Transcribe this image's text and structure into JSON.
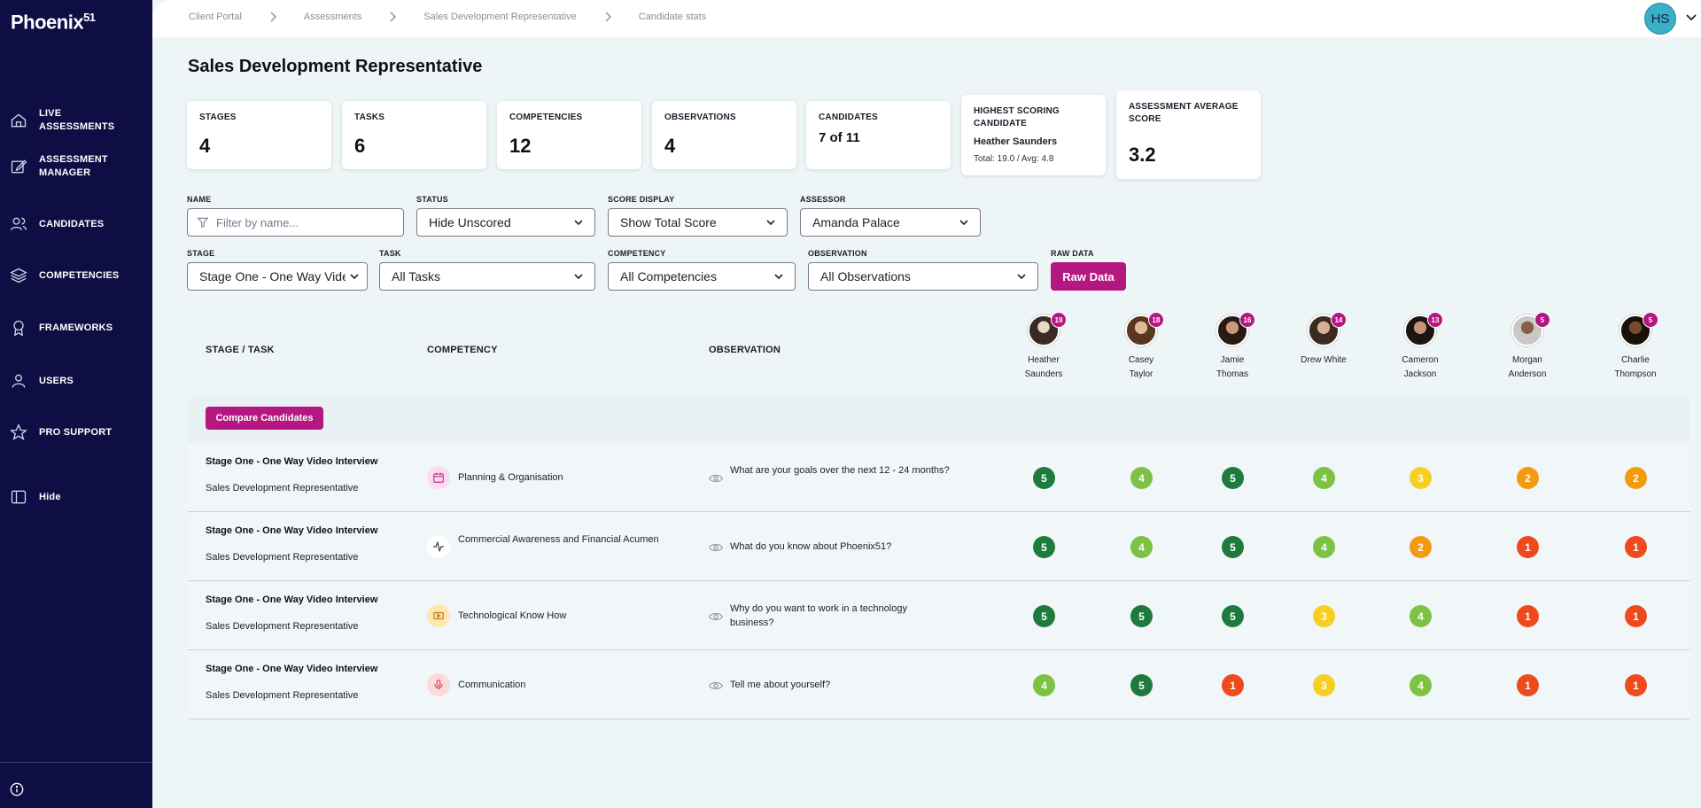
{
  "brand": {
    "name": "Phoenix",
    "suffix": "51"
  },
  "nav": [
    {
      "line1": "LIVE",
      "line2": "ASSESSMENTS",
      "icon": "home-icon"
    },
    {
      "line1": "ASSESSMENT",
      "line2": "MANAGER",
      "icon": "edit-icon"
    },
    {
      "line1": "CANDIDATES",
      "line2": "",
      "icon": "users-icon"
    },
    {
      "line1": "COMPETENCIES",
      "line2": "",
      "icon": "layers-icon"
    },
    {
      "line1": "FRAMEWORKS",
      "line2": "",
      "icon": "award-icon"
    },
    {
      "line1": "USERS",
      "line2": "",
      "icon": "user-icon"
    },
    {
      "line1": "PRO SUPPORT",
      "line2": "",
      "icon": "star-icon"
    },
    {
      "line1": "Hide",
      "line2": "",
      "icon": "sidebar-toggle-icon"
    }
  ],
  "breadcrumb": [
    "Client Portal",
    "Assessments",
    "Sales Development Representative",
    "Candidate stats"
  ],
  "user": {
    "initials": "HS"
  },
  "page": {
    "title": "Sales Development Representative"
  },
  "stats": {
    "stages": {
      "label": "STAGES",
      "value": "4"
    },
    "tasks": {
      "label": "TASKS",
      "value": "6"
    },
    "competencies": {
      "label": "COMPETENCIES",
      "value": "12"
    },
    "observations": {
      "label": "OBSERVATIONS",
      "value": "4"
    },
    "candidates": {
      "label": "CANDIDATES",
      "value": "7 of 11"
    },
    "highest": {
      "label": "HIGHEST SCORING CANDIDATE",
      "name": "Heather Saunders",
      "detail": "Total: 19.0 / Avg: 4.8"
    },
    "average": {
      "label": "ASSESSMENT AVERAGE SCORE",
      "value": "3.2"
    }
  },
  "filters": {
    "name": {
      "label": "NAME",
      "placeholder": "Filter by name..."
    },
    "status": {
      "label": "STATUS",
      "value": "Hide Unscored"
    },
    "score_display": {
      "label": "SCORE DISPLAY",
      "value": "Show Total Score"
    },
    "assessor": {
      "label": "ASSESSOR",
      "value": "Amanda Palace"
    },
    "stage": {
      "label": "STAGE",
      "value": "Stage One - One Way Video Interview"
    },
    "task": {
      "label": "TASK",
      "value": "All Tasks"
    },
    "competency": {
      "label": "COMPETENCY",
      "value": "All Competencies"
    },
    "observation": {
      "label": "OBSERVATION",
      "value": "All Observations"
    },
    "raw_data": {
      "label": "RAW DATA",
      "button": "Raw Data"
    }
  },
  "table": {
    "headers": {
      "stage_task": "STAGE / TASK",
      "competency": "COMPETENCY",
      "observation": "OBSERVATION"
    },
    "compare_button": "Compare Candidates",
    "candidates": [
      {
        "first": "Heather",
        "last": "Saunders",
        "total": "19"
      },
      {
        "first": "Casey",
        "last": "Taylor",
        "total": "18"
      },
      {
        "first": "Jamie",
        "last": "Thomas",
        "total": "16"
      },
      {
        "first": "Drew White",
        "last": "",
        "total": "14"
      },
      {
        "first": "Cameron",
        "last": "Jackson",
        "total": "13"
      },
      {
        "first": "Morgan",
        "last": "Anderson",
        "total": "5"
      },
      {
        "first": "Charlie",
        "last": "Thompson",
        "total": "5"
      }
    ],
    "rows": [
      {
        "stage": "Stage One - One Way Video Interview",
        "task": "Sales Development Representative",
        "competency": "Planning & Organisation",
        "comp_icon": "calendar-icon",
        "observation": "What are your goals over the next 12 - 24 months?",
        "scores": [
          5,
          4,
          5,
          4,
          3,
          2,
          2
        ]
      },
      {
        "stage": "Stage One - One Way Video Interview",
        "task": "Sales Development Representative",
        "competency": "Commercial Awareness and Financial Acumen",
        "comp_icon": "activity-icon",
        "observation": "What do you know about Phoenix51?",
        "scores": [
          5,
          4,
          5,
          4,
          2,
          1,
          1
        ]
      },
      {
        "stage": "Stage One - One Way Video Interview",
        "task": "Sales Development Representative",
        "competency": "Technological Know How",
        "comp_icon": "video-icon",
        "observation": "Why do you want to work in a technology business?",
        "scores": [
          5,
          5,
          5,
          3,
          4,
          1,
          1
        ]
      },
      {
        "stage": "Stage One - One Way Video Interview",
        "task": "Sales Development Representative",
        "competency": "Communication",
        "comp_icon": "microphone-icon",
        "observation": "Tell me about yourself?",
        "scores": [
          4,
          5,
          1,
          3,
          4,
          1,
          1
        ]
      }
    ]
  },
  "colors": {
    "sidebar": "#0e0e44",
    "accent": "#b4177f",
    "score_5": "#1f7a3e",
    "score_4": "#7cc243",
    "score_3": "#f7cf23",
    "score_2": "#f49a12",
    "score_1": "#ee4a1d"
  }
}
